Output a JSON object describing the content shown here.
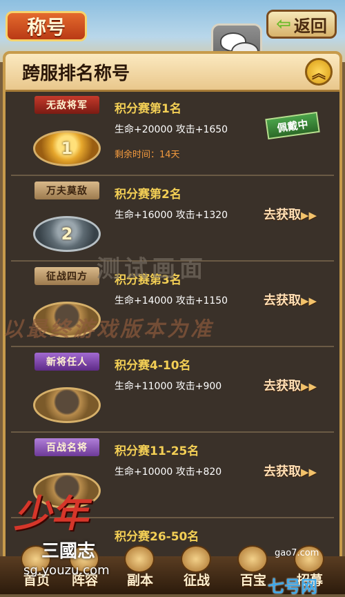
{
  "header": {
    "title": "称号",
    "back_label": "返回"
  },
  "panel": {
    "title": "跨服排名称号"
  },
  "rows": [
    {
      "ribbon": "无敌将军",
      "number": "1",
      "title": "积分赛第1名",
      "stats": "生命+20000  攻击+1650",
      "timer": "剩余时间：14天",
      "status": "佩戴中"
    },
    {
      "ribbon": "万夫莫敌",
      "number": "2",
      "title": "积分赛第2名",
      "stats": "生命+16000  攻击+1320",
      "action": "去获取"
    },
    {
      "ribbon": "征战四方",
      "title": "积分赛第3名",
      "stats": "生命+14000  攻击+1150",
      "action": "去获取"
    },
    {
      "ribbon": "新将任人",
      "title": "积分赛4-10名",
      "stats": "生命+11000  攻击+900",
      "action": "去获取"
    },
    {
      "ribbon": "百战名将",
      "title": "积分赛11-25名",
      "stats": "生命+10000  攻击+820",
      "action": "去获取"
    },
    {
      "title": "积分赛26-50名"
    }
  ],
  "watermark": {
    "line1": "测试画面",
    "line2": "以最终游戏版本为准"
  },
  "logo": {
    "main": "少年",
    "sub": "三國志",
    "url": "sg.youzu.com"
  },
  "nav": [
    "首页",
    "阵容",
    "副本",
    "征战",
    "百宝",
    "招募"
  ],
  "source": "gao7.com",
  "corner": "七号网"
}
